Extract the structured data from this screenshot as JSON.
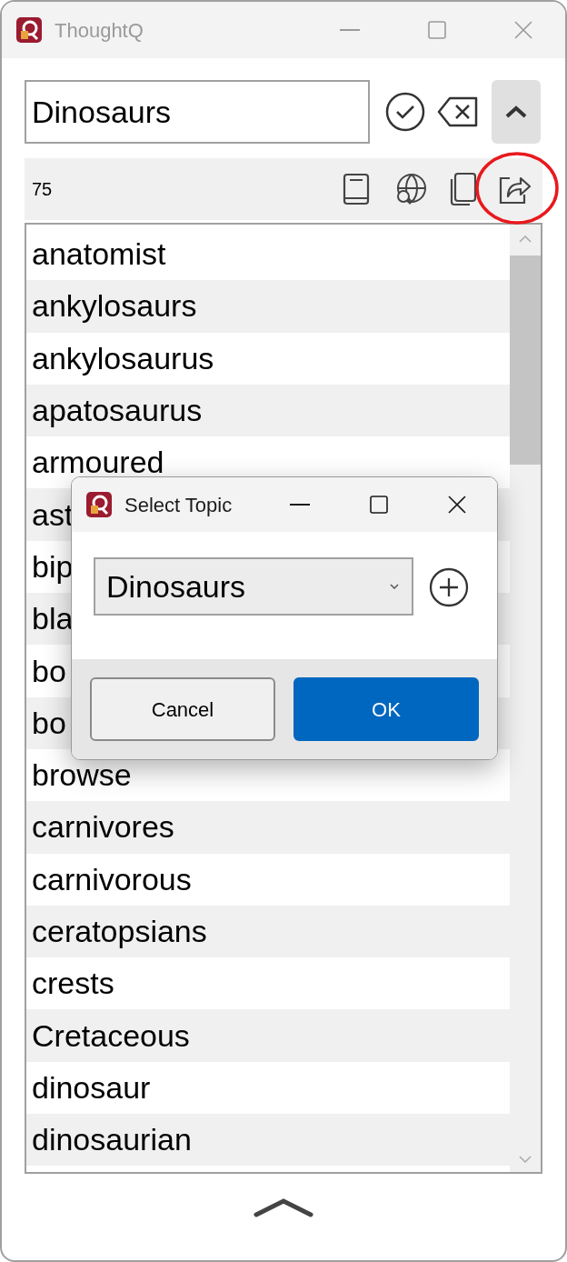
{
  "window": {
    "title": "ThoughtQ",
    "active": false
  },
  "search": {
    "value": "Dinosaurs"
  },
  "toolbar": {
    "count": "75"
  },
  "words": [
    "anatomist",
    "ankylosaurs",
    "ankylosaurus",
    "apatosaurus",
    "armoured",
    "ast",
    "bip",
    "bla",
    "bo",
    "bo",
    "browse",
    "carnivores",
    "carnivorous",
    "ceratopsians",
    "crests",
    "Cretaceous",
    "dinosaur",
    "dinosaurian"
  ],
  "dialog": {
    "title": "Select Topic",
    "active": true,
    "topic": {
      "value": "Dinosaurs"
    },
    "buttons": [
      {
        "label": "Cancel",
        "kind": "secondary"
      },
      {
        "label": "OK",
        "kind": "primary"
      }
    ]
  }
}
